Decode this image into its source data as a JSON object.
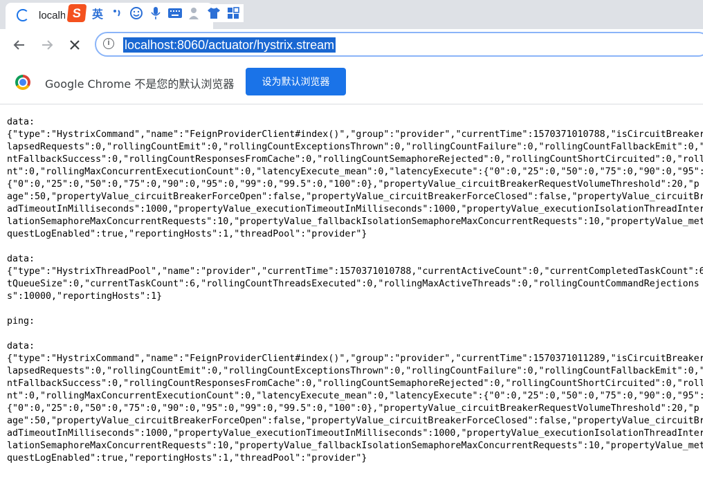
{
  "tab": {
    "title": "localh"
  },
  "ime": {
    "logo": "S",
    "lang": "英",
    "icons": [
      "punct-icon",
      "emoji-icon",
      "mic-icon",
      "keyboard-icon",
      "user-icon",
      "shirt-icon",
      "grid-icon"
    ]
  },
  "toolbar": {
    "url": "localhost:8060/actuator/hystrix.stream"
  },
  "infobar": {
    "message": "Google Chrome 不是您的默认浏览器",
    "button": "设为默认浏览器"
  },
  "stream_lines": [
    "data:",
    "{\"type\":\"HystrixCommand\",\"name\":\"FeignProviderClient#index()\",\"group\":\"provider\",\"currentTime\":1570371010788,\"isCircuitBreaker",
    "lapsedRequests\":0,\"rollingCountEmit\":0,\"rollingCountExceptionsThrown\":0,\"rollingCountFailure\":0,\"rollingCountFallbackEmit\":0,\"",
    "ntFallbackSuccess\":0,\"rollingCountResponsesFromCache\":0,\"rollingCountSemaphoreRejected\":0,\"rollingCountShortCircuited\":0,\"roll",
    "nt\":0,\"rollingMaxConcurrentExecutionCount\":0,\"latencyExecute_mean\":0,\"latencyExecute\":{\"0\":0,\"25\":0,\"50\":0,\"75\":0,\"90\":0,\"95\":",
    "{\"0\":0,\"25\":0,\"50\":0,\"75\":0,\"90\":0,\"95\":0,\"99\":0,\"99.5\":0,\"100\":0},\"propertyValue_circuitBreakerRequestVolumeThreshold\":20,\"p",
    "age\":50,\"propertyValue_circuitBreakerForceOpen\":false,\"propertyValue_circuitBreakerForceClosed\":false,\"propertyValue_circuitBr",
    "adTimeoutInMilliseconds\":1000,\"propertyValue_executionTimeoutInMilliseconds\":1000,\"propertyValue_executionIsolationThreadInter",
    "lationSemaphoreMaxConcurrentRequests\":10,\"propertyValue_fallbackIsolationSemaphoreMaxConcurrentRequests\":10,\"propertyValue_met",
    "questLogEnabled\":true,\"reportingHosts\":1,\"threadPool\":\"provider\"}",
    "",
    "data:",
    "{\"type\":\"HystrixThreadPool\",\"name\":\"provider\",\"currentTime\":1570371010788,\"currentActiveCount\":0,\"currentCompletedTaskCount\":6",
    "tQueueSize\":0,\"currentTaskCount\":6,\"rollingCountThreadsExecuted\":0,\"rollingMaxActiveThreads\":0,\"rollingCountCommandRejections",
    "s\":10000,\"reportingHosts\":1}",
    "",
    "ping:",
    "",
    "data:",
    "{\"type\":\"HystrixCommand\",\"name\":\"FeignProviderClient#index()\",\"group\":\"provider\",\"currentTime\":1570371011289,\"isCircuitBreaker",
    "lapsedRequests\":0,\"rollingCountEmit\":0,\"rollingCountExceptionsThrown\":0,\"rollingCountFailure\":0,\"rollingCountFallbackEmit\":0,\"",
    "ntFallbackSuccess\":0,\"rollingCountResponsesFromCache\":0,\"rollingCountSemaphoreRejected\":0,\"rollingCountShortCircuited\":0,\"roll",
    "nt\":0,\"rollingMaxConcurrentExecutionCount\":0,\"latencyExecute_mean\":0,\"latencyExecute\":{\"0\":0,\"25\":0,\"50\":0,\"75\":0,\"90\":0,\"95\":",
    "{\"0\":0,\"25\":0,\"50\":0,\"75\":0,\"90\":0,\"95\":0,\"99\":0,\"99.5\":0,\"100\":0},\"propertyValue_circuitBreakerRequestVolumeThreshold\":20,\"p",
    "age\":50,\"propertyValue_circuitBreakerForceOpen\":false,\"propertyValue_circuitBreakerForceClosed\":false,\"propertyValue_circuitBr",
    "adTimeoutInMilliseconds\":1000,\"propertyValue_executionTimeoutInMilliseconds\":1000,\"propertyValue_executionIsolationThreadInter",
    "lationSemaphoreMaxConcurrentRequests\":10,\"propertyValue_fallbackIsolationSemaphoreMaxConcurrentRequests\":10,\"propertyValue_met",
    "questLogEnabled\":true,\"reportingHosts\":1,\"threadPool\":\"provider\"}"
  ]
}
